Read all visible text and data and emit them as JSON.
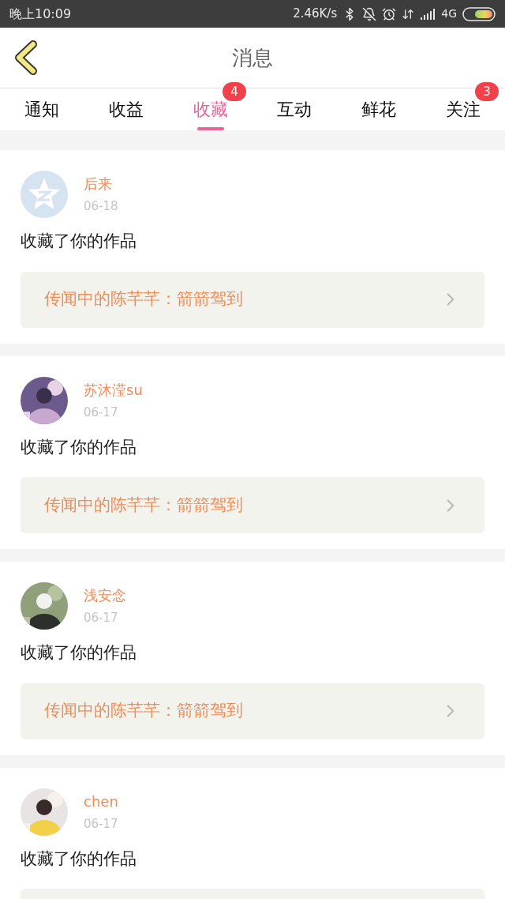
{
  "status_bar": {
    "time": "晚上10:09",
    "speed": "2.46K/s",
    "network": "4G"
  },
  "header": {
    "title": "消息"
  },
  "tabs": [
    {
      "label": "通知",
      "selected": false
    },
    {
      "label": "收益",
      "selected": false
    },
    {
      "label": "收藏",
      "selected": true,
      "badge": "4"
    },
    {
      "label": "互动",
      "selected": false
    },
    {
      "label": "鲜花",
      "selected": false
    },
    {
      "label": "关注",
      "selected": false,
      "badge": "3"
    }
  ],
  "messages": [
    {
      "kind": "default",
      "name": "后来",
      "date": "06-18",
      "text": "收藏了你的作品",
      "work": "传闻中的陈芊芊：箭箭驾到"
    },
    {
      "kind": "picture",
      "name": "苏沐滢su",
      "date": "06-17",
      "text": "收藏了你的作品",
      "work": "传闻中的陈芊芊：箭箭驾到"
    },
    {
      "kind": "picture",
      "name": "浅安念",
      "date": "06-17",
      "text": "收藏了你的作品",
      "work": "传闻中的陈芊芊：箭箭驾到"
    },
    {
      "kind": "picture",
      "name": "chen",
      "date": "06-17",
      "text": "收藏了你的作品"
    }
  ]
}
